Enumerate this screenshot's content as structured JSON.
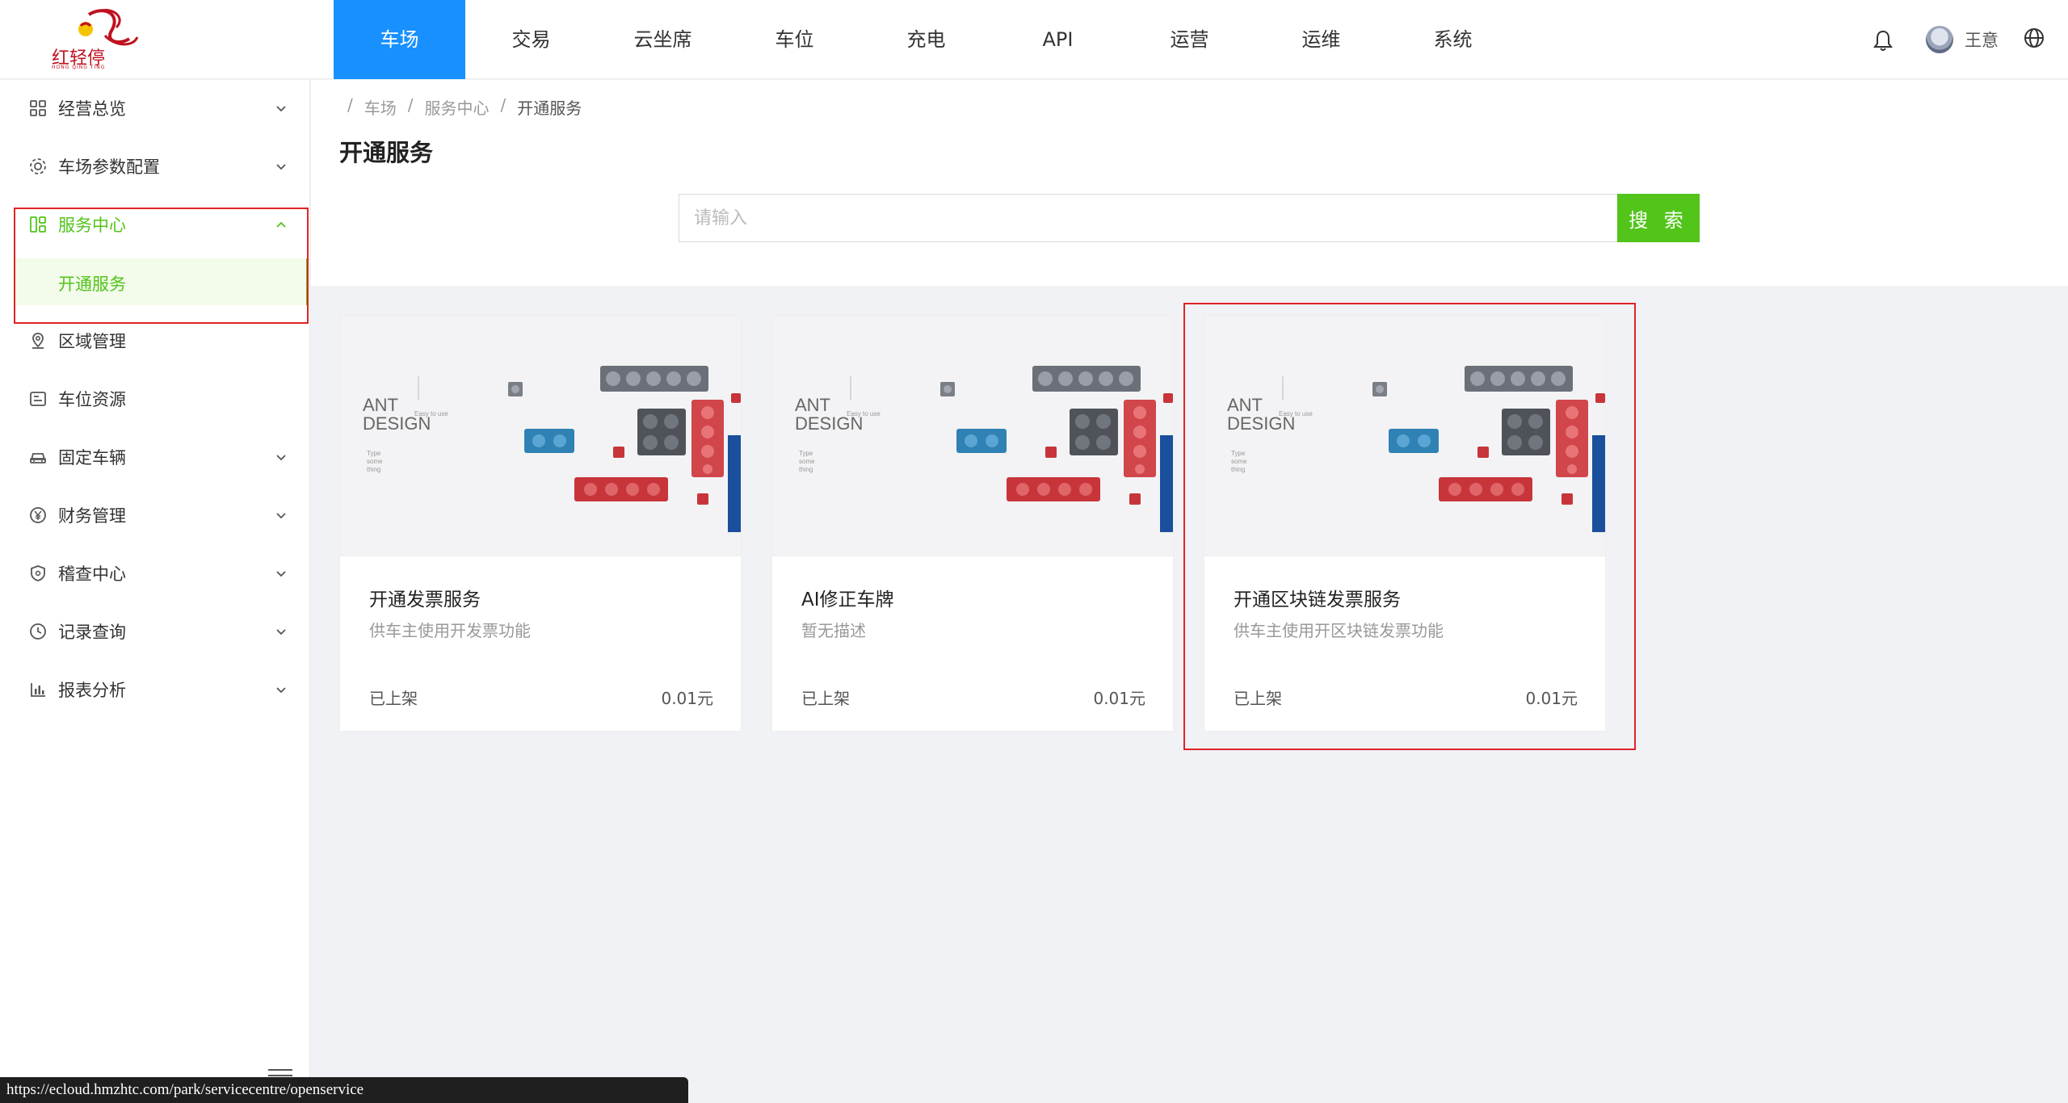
{
  "logo": {
    "text": "红轻停",
    "sub": "HONG QING TING"
  },
  "nav": {
    "items": [
      {
        "label": "车场",
        "active": true
      },
      {
        "label": "交易",
        "active": false
      },
      {
        "label": "云坐席",
        "active": false
      },
      {
        "label": "车位",
        "active": false
      },
      {
        "label": "充电",
        "active": false
      },
      {
        "label": "API",
        "active": false
      },
      {
        "label": "运营",
        "active": false
      },
      {
        "label": "运维",
        "active": false
      },
      {
        "label": "系统",
        "active": false
      }
    ],
    "accent": "#1890ff"
  },
  "user": {
    "name": "王意"
  },
  "sidebar": {
    "items": [
      {
        "label": "经营总览",
        "icon": "grid-icon"
      },
      {
        "label": "车场参数配置",
        "icon": "gear-icon"
      },
      {
        "label": "服务中心",
        "icon": "apps-icon"
      },
      {
        "label": "区域管理",
        "icon": "location-icon"
      },
      {
        "label": "车位资源",
        "icon": "parking-icon"
      },
      {
        "label": "固定车辆",
        "icon": "car-icon"
      },
      {
        "label": "财务管理",
        "icon": "yen-icon"
      },
      {
        "label": "稽查中心",
        "icon": "shield-icon"
      },
      {
        "label": "记录查询",
        "icon": "clock-icon"
      },
      {
        "label": "报表分析",
        "icon": "bar-chart-icon"
      }
    ],
    "sub_active": "开通服务",
    "active_color": "#52c41a"
  },
  "breadcrumb": [
    "车场",
    "服务中心",
    "开通服务"
  ],
  "page_title": "开通服务",
  "search": {
    "placeholder": "请输入",
    "button": "搜 索"
  },
  "cards": [
    {
      "title": "开通发票服务",
      "desc": "供车主使用开发票功能",
      "status": "已上架",
      "price": "0.01元"
    },
    {
      "title": "AI修正车牌",
      "desc": "暂无描述",
      "status": "已上架",
      "price": "0.01元"
    },
    {
      "title": "开通区块链发票服务",
      "desc": "供车主使用开区块链发票功能",
      "status": "已上架",
      "price": "0.01元"
    }
  ],
  "card_image": {
    "brand_line1": "ANT",
    "brand_line2": "DESIGN",
    "tagline": "Easy to use",
    "small": [
      "Type",
      "some",
      "thing"
    ]
  },
  "statusbar": {
    "url": "https://ecloud.hmzhtc.com/park/servicecentre/openservice"
  }
}
